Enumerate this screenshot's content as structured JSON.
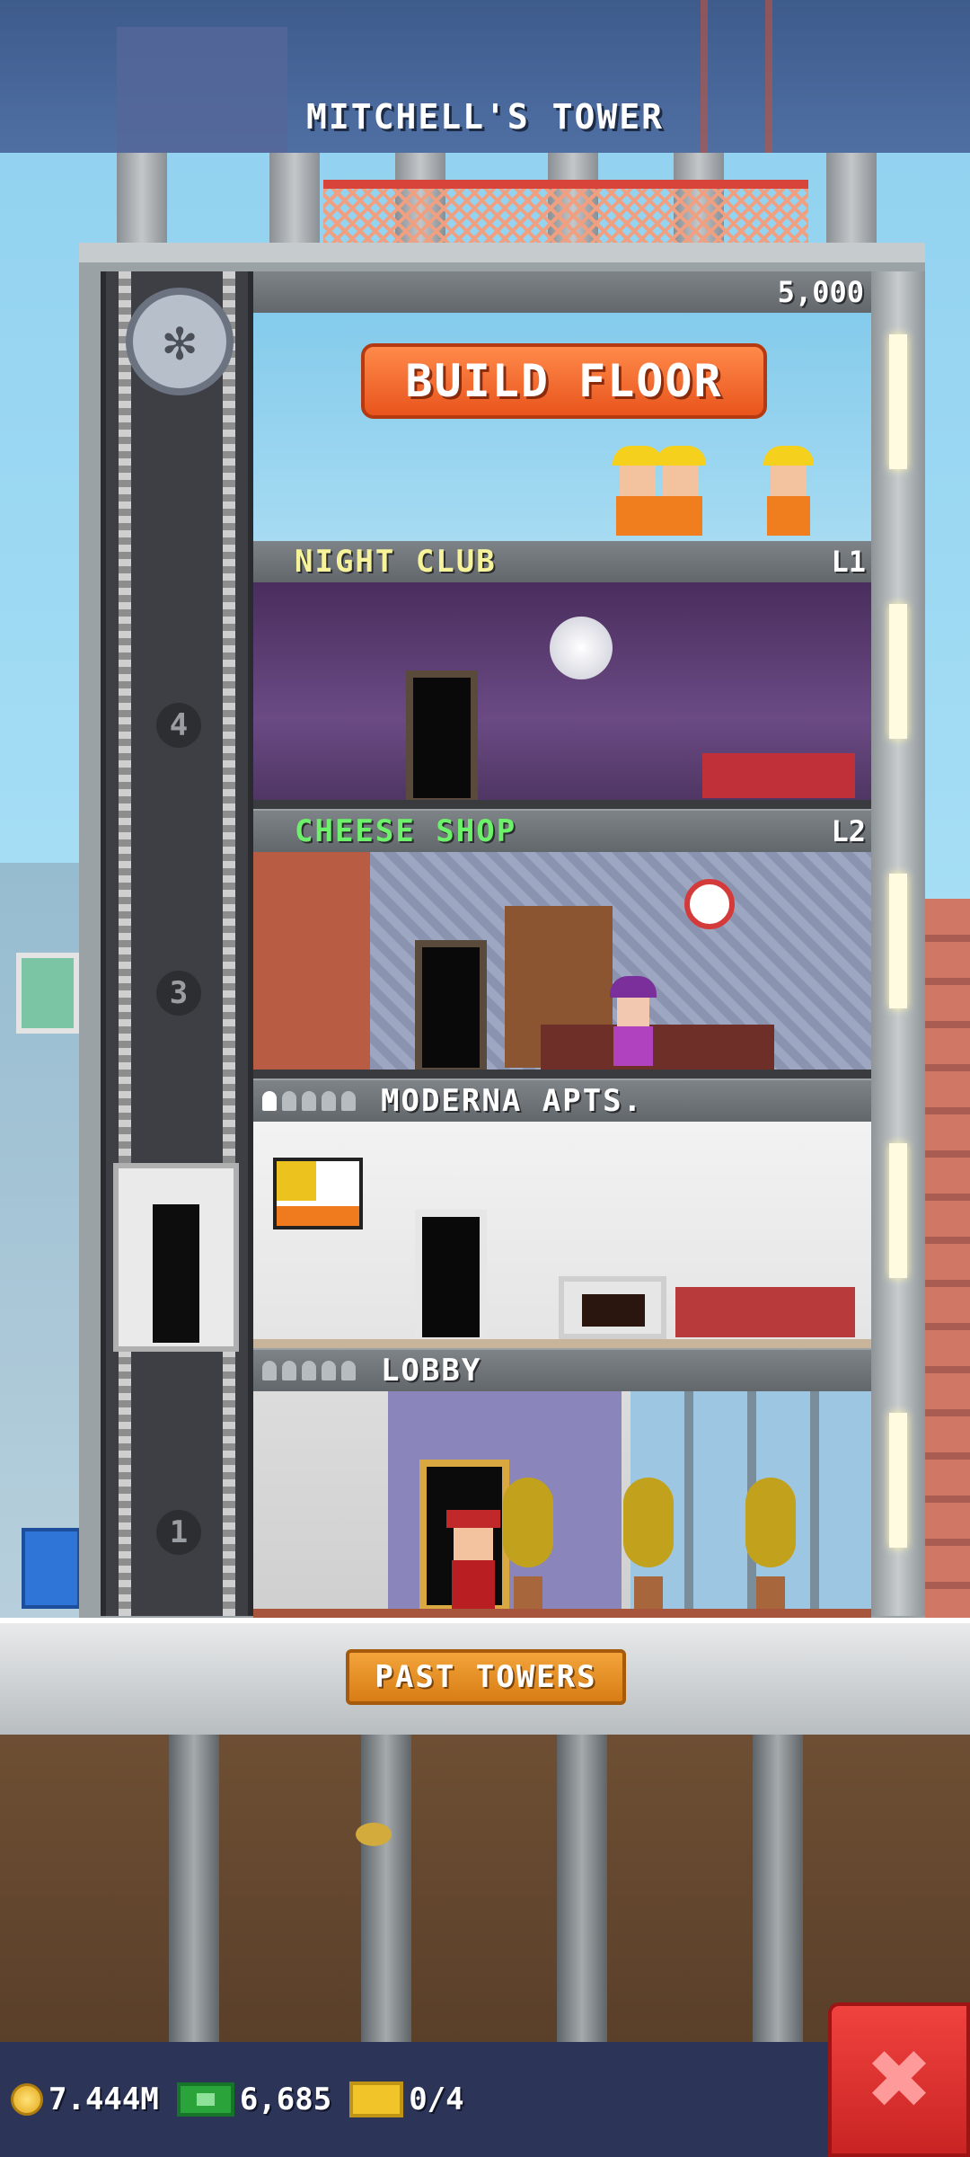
{
  "header": {
    "title": "MITCHELL'S TOWER"
  },
  "build": {
    "cost": "5,000",
    "button_label": "BUILD FLOOR"
  },
  "floors": [
    {
      "name": "NIGHT CLUB",
      "level": "L1",
      "name_color": "#f6f39a"
    },
    {
      "name": "CHEESE SHOP",
      "level": "L2",
      "name_color": "#6df06a"
    },
    {
      "name": "MODERNA APTS.",
      "level": "",
      "name_color": "#ffffff",
      "residents_filled": 1,
      "residents_total": 5
    },
    {
      "name": "LOBBY",
      "level": "",
      "name_color": "#ffffff"
    }
  ],
  "elevator": {
    "floor_numbers": [
      "4",
      "3",
      "1"
    ]
  },
  "past_towers": {
    "label": "PAST TOWERS"
  },
  "stats": {
    "coins": "7.444M",
    "bux": "6,685",
    "tickets": "0/4"
  },
  "close": {
    "icon": "close-x-icon",
    "glyph": "✖"
  },
  "colors": {
    "build_button": "#f26a2b",
    "close_button": "#e0302e",
    "bottom_bar": "#2c3558"
  }
}
